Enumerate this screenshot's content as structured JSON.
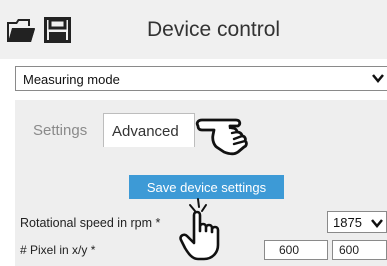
{
  "header": {
    "title": "Device control",
    "icons": [
      "folder-open-icon",
      "save-icon"
    ]
  },
  "mode_select": {
    "selected": "Measuring mode",
    "chevron": "chevron-down-icon"
  },
  "tabs": [
    {
      "label": "Settings",
      "active": false
    },
    {
      "label": "Advanced",
      "active": true
    }
  ],
  "save_button": {
    "label": "Save device settings",
    "color": "#3d9ad6"
  },
  "fields": {
    "rotational_speed": {
      "label": "Rotational speed in rpm *",
      "value": "1875"
    },
    "pixel": {
      "label": "# Pixel in x/y *",
      "x": "600",
      "y": "600"
    }
  },
  "annotations": [
    "pointing-hand-icon",
    "click-hand-icon"
  ]
}
